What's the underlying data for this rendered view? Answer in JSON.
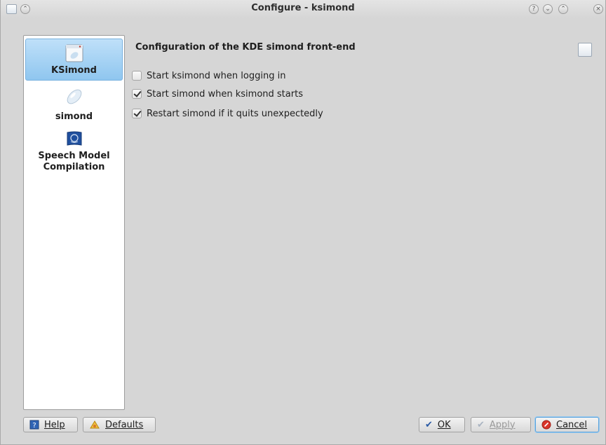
{
  "window": {
    "title": "Configure - ksimond",
    "title_buttons": [
      "shade-icon",
      "help-icon",
      "minimize-icon",
      "maximize-icon",
      "close-icon"
    ]
  },
  "sidebar": {
    "items": [
      {
        "label": "KSimond",
        "icon": "ksimond-app-icon",
        "selected": true
      },
      {
        "label": "simond",
        "icon": "simond-icon",
        "selected": false
      },
      {
        "label": "Speech Model Compilation",
        "icon": "speech-model-flag-icon",
        "selected": false
      }
    ]
  },
  "page": {
    "header": "Configuration of the KDE simond front-end",
    "options": [
      {
        "label": "Start ksimond when logging in",
        "checked": false
      },
      {
        "label": "Start simond when ksimond starts",
        "checked": true
      },
      {
        "label": "Restart simond if it quits unexpectedly",
        "checked": true
      }
    ]
  },
  "buttons": {
    "help": "Help",
    "defaults": "Defaults",
    "ok": "OK",
    "apply": "Apply",
    "cancel": "Cancel"
  },
  "colors": {
    "selection": "#8fc6ef",
    "focus_border": "#5aa3dc",
    "window_bg": "#d6d6d6"
  }
}
